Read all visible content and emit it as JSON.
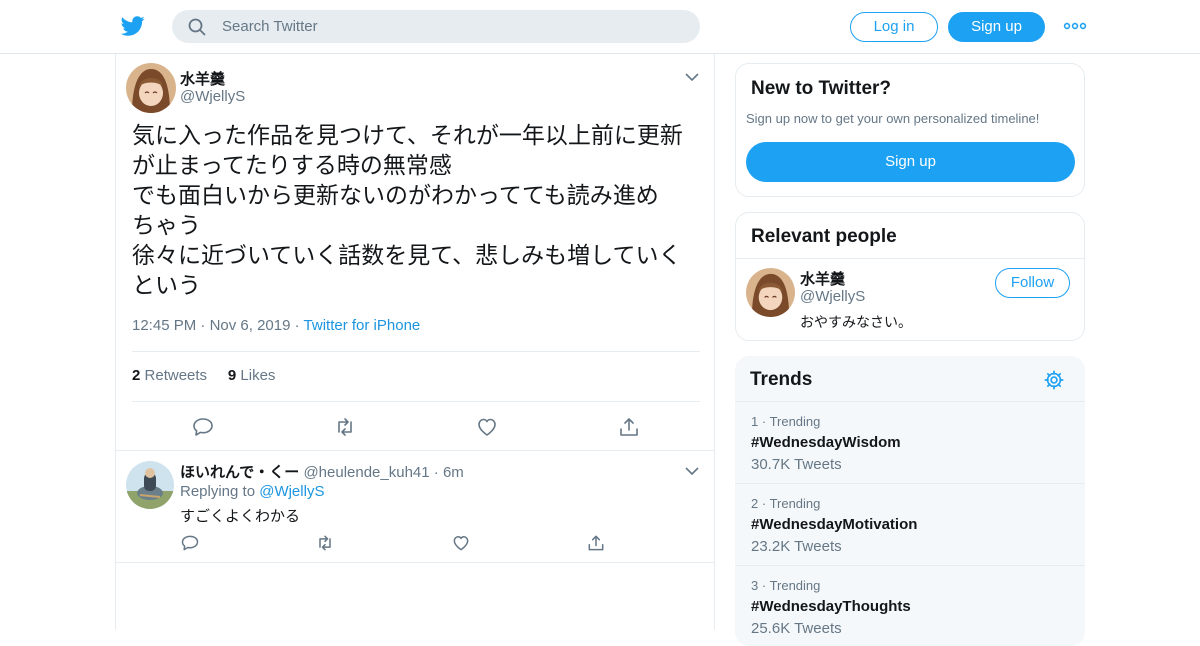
{
  "header": {
    "search_placeholder": "Search Twitter",
    "login_label": "Log in",
    "signup_label": "Sign up"
  },
  "tweet": {
    "author_name": "水羊羹",
    "author_handle": "@WjellyS",
    "text_lines": [
      "気に入った作品を見つけて、それが一年以上前に更新",
      "が止まってたりする時の無常感",
      "でも面白いから更新ないのがわかってても読み進め",
      "ちゃう",
      "徐々に近づいていく話数を見て、悲しみも増していく",
      "という"
    ],
    "time": "12:45 PM",
    "date": "Nov 6, 2019",
    "source": "Twitter for iPhone",
    "retweet_count": "2",
    "retweet_label": "Retweets",
    "like_count": "9",
    "like_label": "Likes"
  },
  "reply": {
    "author_name": "ほいれんで・くー",
    "author_handle": "@heulende_kuh41",
    "age": "6m",
    "replying_prefix": "Replying to",
    "replying_to": "@WjellyS",
    "text": "すごくよくわかる"
  },
  "new_to_twitter": {
    "title": "New to Twitter?",
    "subtitle": "Sign up now to get your own personalized timeline!",
    "signup_label": "Sign up"
  },
  "relevant": {
    "title": "Relevant people",
    "name": "水羊羹",
    "handle": "@WjellyS",
    "bio": "おやすみなさい。",
    "follow_label": "Follow"
  },
  "trends": {
    "title": "Trends",
    "items": [
      {
        "rank": "1",
        "label": "Trending",
        "tag": "#WednesdayWisdom",
        "count": "30.7K Tweets"
      },
      {
        "rank": "2",
        "label": "Trending",
        "tag": "#WednesdayMotivation",
        "count": "23.2K Tweets"
      },
      {
        "rank": "3",
        "label": "Trending",
        "tag": "#WednesdayThoughts",
        "count": "25.6K Tweets"
      }
    ]
  },
  "colors": {
    "brand": "#1da1f2",
    "link": "#1b95e0",
    "secondary_text": "#657786"
  },
  "icons": [
    "twitter-logo-icon",
    "search-icon",
    "more-dots-icon",
    "chevron-down-icon",
    "reply-icon",
    "retweet-icon",
    "like-icon",
    "share-icon",
    "gear-icon"
  ]
}
